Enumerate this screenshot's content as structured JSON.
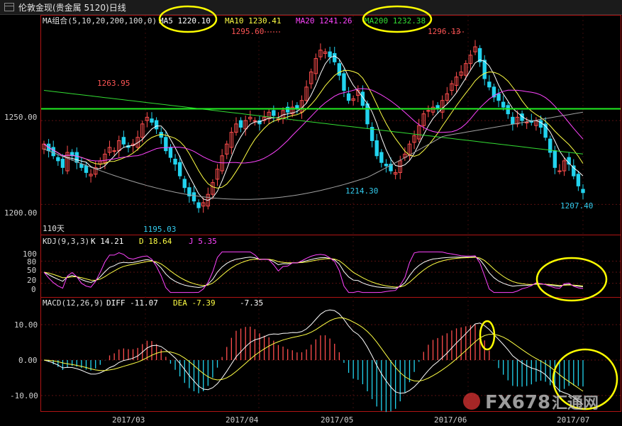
{
  "window": {
    "title": "伦敦金现(贵金属 5120)日线"
  },
  "colors": {
    "background": "#000000",
    "panel_border": "#b01414",
    "up": "#ff4d4d",
    "down": "#22d3ee",
    "ma5": "#ffffff",
    "ma10": "#ffff44",
    "ma20": "#ff44ff",
    "ma200": "#33dd33",
    "ma100": "#a0a0a0",
    "hline": "#22ee22",
    "highlight_ellipse": "#ffff00"
  },
  "legend": {
    "ma_group": "MA组合(5,10,20,200,100,0)",
    "ma5": "MA5 1220.10",
    "ma10": "MA10 1230.41",
    "ma20": "MA20 1241.26",
    "ma200": "MA200 1232.38",
    "kdj_title": "KDJ(9,3,3)",
    "kdj_k": "K  14.21",
    "kdj_d": "D  18.64",
    "kdj_j": "J  5.35",
    "macd_title": "MACD(12,26,9)",
    "macd_diff": "DIFF  -11.07",
    "macd_dea": "DEA  -7.39",
    "macd_val": "-7.35",
    "period": "110天"
  },
  "price_labels": {
    "high1": "1263.95",
    "high2": "1295.60",
    "high3": "1296.13",
    "low1": "1195.03",
    "low2": "1214.30",
    "low3": "1207.40"
  },
  "price_axis": [
    "1250.00",
    "1200.00"
  ],
  "kdj_axis": [
    "100",
    "80",
    "50",
    "20",
    "0"
  ],
  "macd_axis": [
    "10.00",
    "0.00",
    "-10.00"
  ],
  "dates": [
    "2017/03",
    "2017/04",
    "2017/05",
    "2017/06",
    "2017/07"
  ],
  "watermark": {
    "text": "FX678",
    "subtext": "汇通网"
  },
  "chart_data": {
    "type": "candlestick",
    "series": "XAUUSD daily",
    "price_ylim": [
      1190,
      1305
    ],
    "reference_line": 1257,
    "highs_marked": [
      1263.95,
      1295.6,
      1296.13
    ],
    "lows_marked": [
      1195.03,
      1214.3,
      1207.4
    ],
    "ma_current": {
      "MA5": 1220.1,
      "MA10": 1230.41,
      "MA20": 1241.26,
      "MA200": 1232.38
    },
    "kdj": {
      "K": 14.21,
      "D": 18.64,
      "J": 5.35,
      "ylim": [
        0,
        100
      ]
    },
    "macd": {
      "DIFF": -11.07,
      "DEA": -7.39,
      "MACD": -7.35,
      "ylim": [
        -15,
        15
      ]
    },
    "closes": [
      1236,
      1232,
      1229,
      1226,
      1222,
      1231,
      1229,
      1225,
      1222,
      1219,
      1218,
      1222,
      1226,
      1230,
      1234,
      1232,
      1238,
      1236,
      1234,
      1236,
      1240,
      1248,
      1252,
      1249,
      1245,
      1240,
      1232,
      1228,
      1224,
      1217,
      1210,
      1205,
      1202,
      1198,
      1201,
      1206,
      1213,
      1221,
      1229,
      1236,
      1243,
      1248,
      1246,
      1250,
      1252,
      1250,
      1248,
      1252,
      1255,
      1253,
      1251,
      1256,
      1255,
      1258,
      1257,
      1262,
      1270,
      1279,
      1287,
      1292,
      1291,
      1288,
      1285,
      1277,
      1268,
      1262,
      1263,
      1268,
      1259,
      1248,
      1238,
      1229,
      1225,
      1223,
      1220,
      1219,
      1226,
      1230,
      1236,
      1241,
      1247,
      1254,
      1256,
      1258,
      1257,
      1262,
      1266,
      1272,
      1276,
      1279,
      1284,
      1289,
      1294,
      1285,
      1275,
      1270,
      1264,
      1262,
      1258,
      1254,
      1248,
      1252,
      1250,
      1249,
      1249,
      1250,
      1246,
      1240,
      1231,
      1222,
      1220,
      1226,
      1224,
      1217,
      1211,
      1207
    ]
  }
}
